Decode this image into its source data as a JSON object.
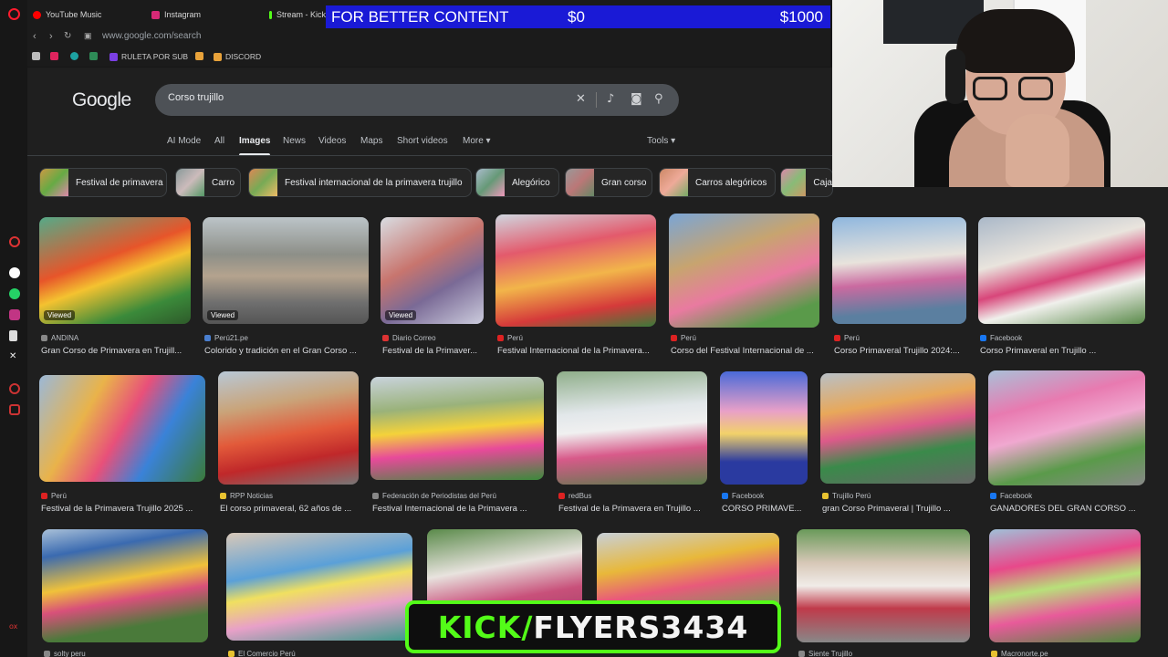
{
  "tabs": [
    {
      "label": "YouTube Music",
      "color": "#ff0000"
    },
    {
      "label": "Instagram",
      "color": "#d62976"
    },
    {
      "label": "Stream - Kick",
      "color": "#53fc18"
    }
  ],
  "banner": {
    "text": "FOR BETTER CONTENT",
    "start": "$0",
    "goal": "$1000"
  },
  "address": {
    "url": "www.google.com/search"
  },
  "bookmarks": [
    {
      "label": "RULETA POR SUB",
      "color": "#7b3fe4"
    },
    {
      "label": "DISCORD",
      "color": "#e8a23a"
    }
  ],
  "google": {
    "logo": "Google",
    "query": "Corso trujillo",
    "filters": [
      {
        "label": "AI Mode",
        "active": false
      },
      {
        "label": "All",
        "active": false
      },
      {
        "label": "Images",
        "active": true
      },
      {
        "label": "News",
        "active": false
      },
      {
        "label": "Videos",
        "active": false
      },
      {
        "label": "Maps",
        "active": false
      },
      {
        "label": "Short videos",
        "active": false
      },
      {
        "label": "More ▾",
        "active": false
      }
    ],
    "tools_label": "Tools ▾",
    "chips": [
      {
        "label": "Festival de primavera"
      },
      {
        "label": "Carro"
      },
      {
        "label": "Festival internacional de la primavera trujillo"
      },
      {
        "label": "Alegórico"
      },
      {
        "label": "Gran corso"
      },
      {
        "label": "Carros alegóricos"
      },
      {
        "label": "Caja"
      }
    ],
    "viewed_label": "Viewed",
    "results": [
      {
        "source": "ANDINA",
        "title": "Gran Corso de Primavera en Trujill...",
        "viewed": true
      },
      {
        "source": "Perú21.pe",
        "title": "Colorido y tradición en el Gran Corso ...",
        "viewed": true
      },
      {
        "source": "Diario Correo",
        "title": "Festival de la Primaver...",
        "viewed": true
      },
      {
        "source": "Perú",
        "title": "Festival Internacional de la Primavera...",
        "viewed": false
      },
      {
        "source": "Perú",
        "title": "Corso del Festival Internacional de ...",
        "viewed": false
      },
      {
        "source": "Perú",
        "title": "Corso Primaveral Trujillo 2024:...",
        "viewed": false
      },
      {
        "source": "Facebook",
        "title": "Corso Primaveral en Trujillo ...",
        "viewed": false
      },
      {
        "source": "Perú",
        "title": "Festival de la Primavera Trujillo 2025 ...",
        "viewed": false
      },
      {
        "source": "RPP Noticias",
        "title": "El corso primaveral, 62 años de ...",
        "viewed": false
      },
      {
        "source": "Federación de Periodistas del Perú",
        "title": "Festival Internacional de la Primavera ...",
        "viewed": false
      },
      {
        "source": "redBus",
        "title": "Festival de la Primavera en Trujillo ...",
        "viewed": false
      },
      {
        "source": "Facebook",
        "title": "CORSO PRIMAVE...",
        "viewed": false
      },
      {
        "source": "Trujillo Perú",
        "title": "gran Corso Primaveral | Trujillo ...",
        "viewed": false
      },
      {
        "source": "Facebook",
        "title": "GANADORES DEL GRAN CORSO ...",
        "viewed": false
      },
      {
        "source": "solty peru",
        "title": "",
        "viewed": false
      },
      {
        "source": "El Comercio Perú",
        "title": "",
        "viewed": false
      },
      {
        "source": "",
        "title": "",
        "viewed": false
      },
      {
        "source": "",
        "title": "",
        "viewed": false
      },
      {
        "source": "Siente Trujillo",
        "title": "",
        "viewed": false
      },
      {
        "source": "Macronorte.pe",
        "title": "",
        "viewed": false
      }
    ]
  },
  "kick_overlay": {
    "prefix": "KICK/",
    "channel": "FLYERS3434"
  }
}
